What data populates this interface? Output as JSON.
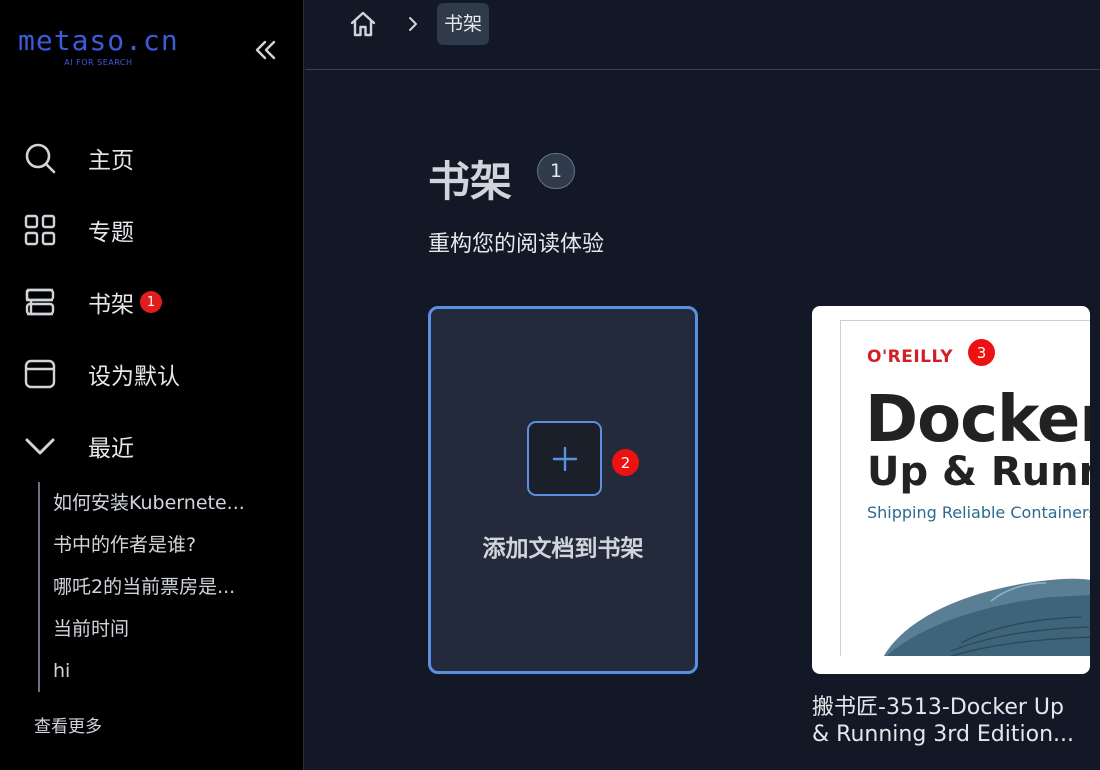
{
  "sidebar": {
    "logo": {
      "text": "metaso.cn",
      "tagline": "AI FOR SEARCH"
    },
    "nav": [
      {
        "label": "主页",
        "icon": "search-icon"
      },
      {
        "label": "专题",
        "icon": "grid-icon"
      },
      {
        "label": "书架",
        "icon": "shelf-icon",
        "badge": "1"
      },
      {
        "label": "设为默认",
        "icon": "window-icon"
      },
      {
        "label": "最近",
        "icon": "chevron-down-icon"
      }
    ],
    "recent": [
      "如何安装Kubernete...",
      "书中的作者是谁?",
      "哪吒2的当前票房是...",
      "当前时间",
      "hi"
    ],
    "see_more": "查看更多"
  },
  "header": {
    "breadcrumb_current": "书架"
  },
  "main": {
    "title": "书架",
    "count": "1",
    "subtitle": "重构您的阅读体验",
    "add_card": {
      "label": "添加文档到书架",
      "marker": "2"
    },
    "book": {
      "marker": "3",
      "cover_publisher": "O'REILLY",
      "cover_title_1": "Docker",
      "cover_title_2": "Up & Running",
      "cover_tagline": "Shipping Reliable Containers in Production",
      "name_line1": "搬书匠-3513-Docker Up",
      "name_line2": "& Running 3rd Edition..."
    }
  },
  "colors": {
    "accent": "#5b8fdf",
    "logo": "#3b5bdb",
    "badge": "#e11d1d",
    "publisher_red": "#d21f26"
  }
}
